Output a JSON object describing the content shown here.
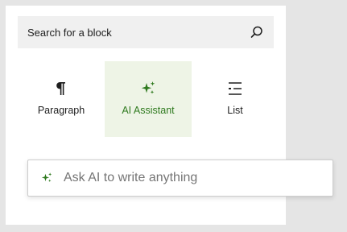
{
  "search": {
    "placeholder": "Search for a block",
    "icon": "search-icon"
  },
  "blocks": [
    {
      "label": "Paragraph",
      "icon": "paragraph-icon"
    },
    {
      "label": "AI Assistant",
      "icon": "sparkle-icon",
      "selected": true
    },
    {
      "label": "List",
      "icon": "list-icon"
    }
  ],
  "ai_prompt": {
    "placeholder": "Ask AI to write anything",
    "icon": "sparkle-icon"
  },
  "colors": {
    "accent": "#2f7a1f",
    "selected_bg": "#eef4e6",
    "panel_bg": "#ffffff",
    "page_bg": "#e5e5e5"
  }
}
